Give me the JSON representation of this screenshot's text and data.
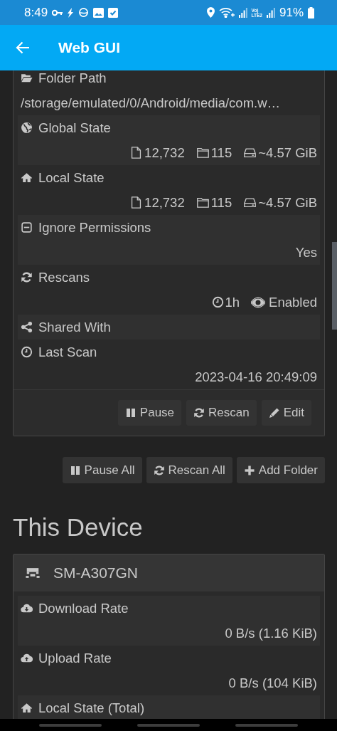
{
  "status_bar": {
    "time": "8:49",
    "network_label": [
      "Vo)",
      "LTE2"
    ],
    "battery": "91%"
  },
  "app_bar": {
    "title": "Web GUI"
  },
  "folder": {
    "rows": [
      {
        "kind": "folder_path",
        "label": "Folder Path",
        "value": "/storage/emulated/0/Android/media/com.w…"
      },
      {
        "kind": "global_state",
        "label": "Global State",
        "files": "12,732",
        "folders": "115",
        "size": "~4.57 GiB"
      },
      {
        "kind": "local_state",
        "label": "Local State",
        "files": "12,732",
        "folders": "115",
        "size": "~4.57 GiB"
      },
      {
        "kind": "ignore_permissions",
        "label": "Ignore Permissions",
        "value": "Yes"
      },
      {
        "kind": "rescans",
        "label": "Rescans",
        "interval": "1h",
        "watcher": "Enabled"
      },
      {
        "kind": "shared_with",
        "label": "Shared With"
      },
      {
        "kind": "last_scan",
        "label": "Last Scan",
        "value": "2023-04-16 20:49:09"
      }
    ],
    "buttons": [
      {
        "kind": "pause",
        "label": "Pause"
      },
      {
        "kind": "rescan",
        "label": "Rescan"
      },
      {
        "kind": "edit",
        "label": "Edit"
      }
    ]
  },
  "folder_actions": [
    {
      "kind": "pause",
      "label": "Pause All"
    },
    {
      "kind": "rescan",
      "label": "Rescan All"
    },
    {
      "kind": "add",
      "label": "Add Folder"
    }
  ],
  "device_section": {
    "heading": "This Device",
    "device": {
      "name": "SM-A307GN",
      "rows": [
        {
          "kind": "download_rate",
          "label": "Download Rate",
          "value": "0 B/s (1.16 KiB)"
        },
        {
          "kind": "upload_rate",
          "label": "Upload Rate",
          "value": "0 B/s (104 KiB)"
        },
        {
          "kind": "local_state_total",
          "label": "Local State (Total)"
        }
      ]
    }
  }
}
